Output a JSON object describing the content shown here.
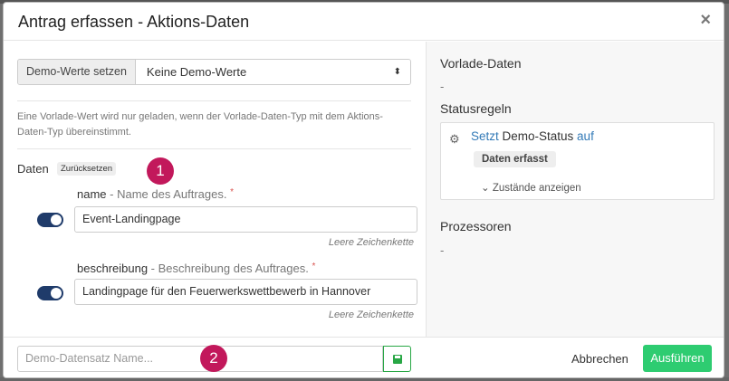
{
  "modal": {
    "title": "Antrag erfassen - Aktions-Daten",
    "close": "×"
  },
  "demo": {
    "addon_label": "Demo-Werte setzen",
    "selected": "Keine Demo-Werte",
    "caret": "⬍"
  },
  "info_text": "Eine Vorlade-Wert wird nur geladen, wenn der Vorlade-Daten-Typ mit dem Aktions-Daten-Typ übereinstimmt.",
  "daten": {
    "label": "Daten",
    "reset": "Zurücksetzen"
  },
  "markers": [
    "1",
    "2"
  ],
  "fields": [
    {
      "name": "name",
      "description": " - Name des Auftrages.",
      "required": "*",
      "value": "Event-Landingpage",
      "hint": "Leere Zeichenkette",
      "enabled": true
    },
    {
      "name": "beschreibung",
      "description": " - Beschreibung des Auftrages.",
      "required": "*",
      "value": "Landingpage für den Feuerwerkswettbewerb in Hannover",
      "hint": "Leere Zeichenkette",
      "enabled": true
    }
  ],
  "footer": {
    "name_placeholder": "Demo-Datensatz Name...",
    "cancel": "Abbrechen",
    "submit": "Ausführen"
  },
  "right": {
    "preload_heading": "Vorlade-Daten",
    "preload_value": "-",
    "rules_heading": "Statusregeln",
    "rule": {
      "kw_set": "Setzt",
      "status": " Demo-Status ",
      "kw_on": "auf",
      "state": "Daten erfasst",
      "expand": "⌄ Zustände anzeigen"
    },
    "processors_heading": "Prozessoren",
    "processors_value": "-"
  },
  "colors": {
    "accent_link": "#337ab7",
    "toggle_on": "#1f3b6a",
    "marker": "#c2185b",
    "success": "#2ecc71"
  }
}
